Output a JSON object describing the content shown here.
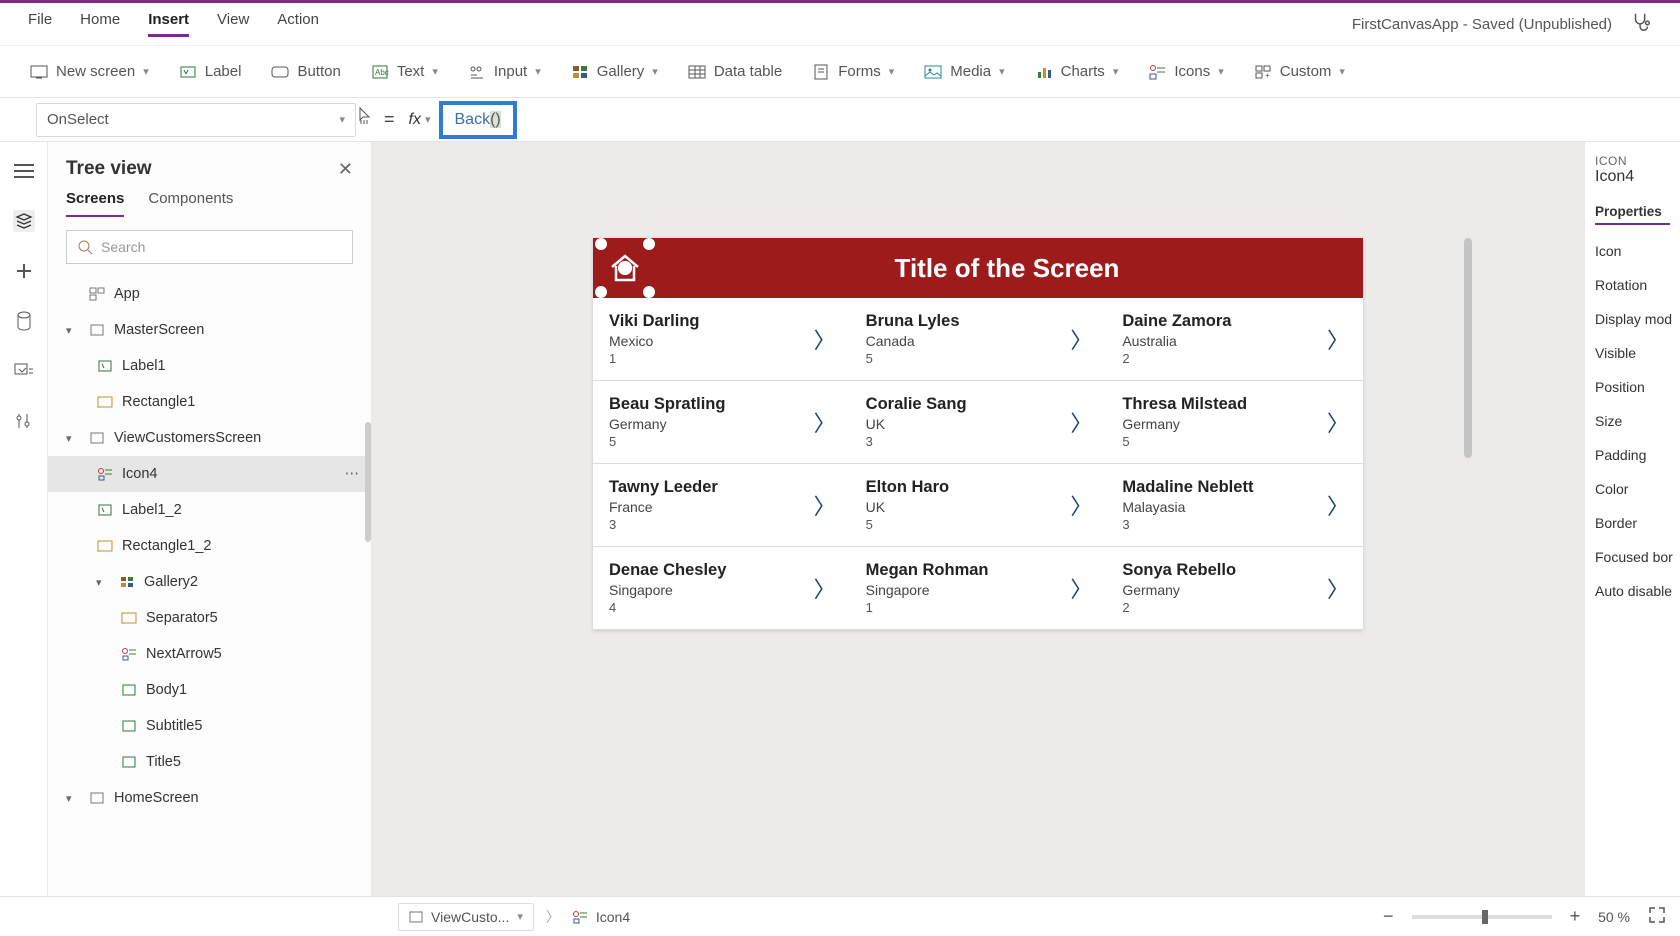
{
  "top_menu": {
    "items": [
      "File",
      "Home",
      "Insert",
      "View",
      "Action"
    ],
    "active_index": 2,
    "app_status": "FirstCanvasApp - Saved (Unpublished)"
  },
  "ribbon": {
    "new_screen": "New screen",
    "label": "Label",
    "button": "Button",
    "text": "Text",
    "input": "Input",
    "gallery": "Gallery",
    "data_table": "Data table",
    "forms": "Forms",
    "media": "Media",
    "charts": "Charts",
    "icons": "Icons",
    "custom": "Custom"
  },
  "formula": {
    "property": "OnSelect",
    "fx": "fx",
    "function": "Back",
    "args": "()"
  },
  "tree": {
    "title": "Tree view",
    "tabs": {
      "screens": "Screens",
      "components": "Components"
    },
    "search_placeholder": "Search",
    "nodes": {
      "app": "App",
      "master": "MasterScreen",
      "label1": "Label1",
      "rect1": "Rectangle1",
      "view": "ViewCustomersScreen",
      "icon4": "Icon4",
      "label1_2": "Label1_2",
      "rect1_2": "Rectangle1_2",
      "gallery2": "Gallery2",
      "sep5": "Separator5",
      "next5": "NextArrow5",
      "body1": "Body1",
      "subtitle5": "Subtitle5",
      "title5": "Title5",
      "home": "HomeScreen"
    }
  },
  "screen": {
    "title": "Title of the Screen",
    "cells": [
      {
        "name": "Viki  Darling",
        "sub": "Mexico",
        "num": "1"
      },
      {
        "name": "Bruna  Lyles",
        "sub": "Canada",
        "num": "5"
      },
      {
        "name": "Daine  Zamora",
        "sub": "Australia",
        "num": "2"
      },
      {
        "name": "Beau  Spratling",
        "sub": "Germany",
        "num": "5"
      },
      {
        "name": "Coralie  Sang",
        "sub": "UK",
        "num": "3"
      },
      {
        "name": "Thresa  Milstead",
        "sub": "Germany",
        "num": "5"
      },
      {
        "name": "Tawny  Leeder",
        "sub": "France",
        "num": "3"
      },
      {
        "name": "Elton  Haro",
        "sub": "UK",
        "num": "5"
      },
      {
        "name": "Madaline  Neblett",
        "sub": "Malayasia",
        "num": "3"
      },
      {
        "name": "Denae  Chesley",
        "sub": "Singapore",
        "num": "4"
      },
      {
        "name": "Megan  Rohman",
        "sub": "Singapore",
        "num": "1"
      },
      {
        "name": "Sonya  Rebello",
        "sub": "Germany",
        "num": "2"
      }
    ]
  },
  "props": {
    "heading_label": "ICON",
    "name": "Icon4",
    "tab": "Properties",
    "rows": [
      "Icon",
      "Rotation",
      "Display mod",
      "Visible",
      "Position",
      "Size",
      "Padding",
      "Color",
      "Border",
      "Focused bor",
      "Auto disable"
    ]
  },
  "bottom": {
    "crumb_screen": "ViewCusto...",
    "crumb_item": "Icon4",
    "zoom_value": "50",
    "zoom_unit": "%"
  }
}
